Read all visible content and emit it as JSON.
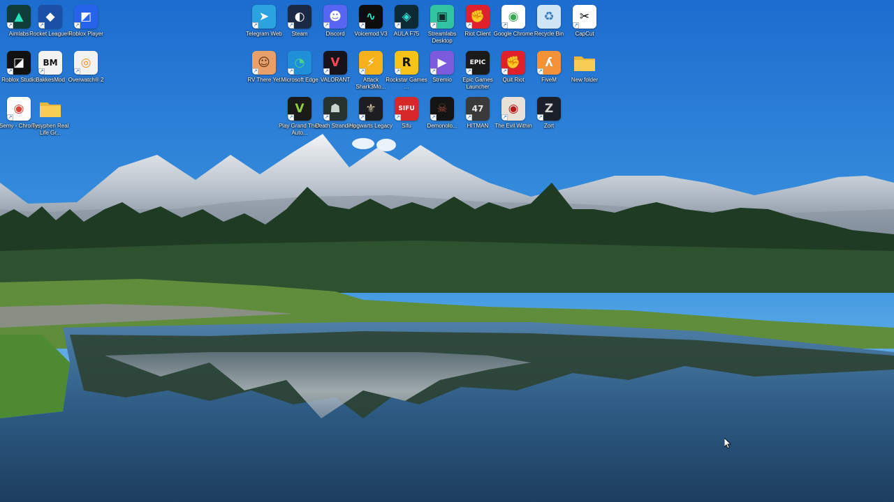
{
  "desktop": {
    "icons": [
      {
        "id": "aimlabs",
        "label": "Aimlabs",
        "icon": "aimlabs-icon",
        "color": "#0f3d3a",
        "fg": "#27e0c0",
        "glyph": "▲"
      },
      {
        "id": "rocket-league",
        "label": "Rocket League®",
        "icon": "rocket-league-icon",
        "color": "#1b4fa8",
        "fg": "#ffffff",
        "glyph": "◆"
      },
      {
        "id": "roblox-player",
        "label": "Roblox Player",
        "icon": "roblox-icon",
        "color": "#2563eb",
        "fg": "#ffffff",
        "glyph": "◩"
      },
      {
        "id": "roblox-studio",
        "label": "Roblox Studio",
        "icon": "roblox-studio-icon",
        "color": "#111111",
        "fg": "#ffffff",
        "glyph": "◪"
      },
      {
        "id": "bakkesmod",
        "label": "BakkesMod",
        "icon": "bakkesmod-icon",
        "color": "#f2f2f2",
        "fg": "#111111",
        "glyph": "BM"
      },
      {
        "id": "overwatch",
        "label": "Overwatch® 2",
        "icon": "overwatch-icon",
        "color": "#f2f2f2",
        "fg": "#f28c1d",
        "glyph": "◎"
      },
      {
        "id": "semy-chrome",
        "label": "Semy - Chrome",
        "icon": "chrome-icon",
        "color": "#ffffff",
        "fg": "#db4437",
        "glyph": "◉"
      },
      {
        "id": "tysyphen",
        "label": "Tysyphen Real Life Gr...",
        "icon": "folder-icon",
        "color": "#f5c542",
        "fg": "#c8961a",
        "glyph": ""
      },
      {
        "id": "telegram",
        "label": "Telegram Web",
        "icon": "telegram-icon",
        "color": "#2aa3e0",
        "fg": "#ffffff",
        "glyph": "➤"
      },
      {
        "id": "steam",
        "label": "Steam",
        "icon": "steam-icon",
        "color": "#1b2a44",
        "fg": "#ffffff",
        "glyph": "◐"
      },
      {
        "id": "discord",
        "label": "Discord",
        "icon": "discord-icon",
        "color": "#5865f2",
        "fg": "#ffffff",
        "glyph": "☻"
      },
      {
        "id": "voicemod",
        "label": "Voicemod V3",
        "icon": "voicemod-icon",
        "color": "#0d0d0d",
        "fg": "#27e8c8",
        "glyph": "∿"
      },
      {
        "id": "aula",
        "label": "AULA F75",
        "icon": "aula-icon",
        "color": "#0b2a36",
        "fg": "#2de0d6",
        "glyph": "◈"
      },
      {
        "id": "streamlabs",
        "label": "Streamlabs Desktop",
        "icon": "streamlabs-icon",
        "color": "#31c3a2",
        "fg": "#0d2b28",
        "glyph": "▣"
      },
      {
        "id": "riot-client",
        "label": "Riot Client",
        "icon": "riot-icon",
        "color": "#e0212b",
        "fg": "#ffffff",
        "glyph": "✊"
      },
      {
        "id": "google-chrome",
        "label": "Google Chrome",
        "icon": "chrome-icon",
        "color": "#ffffff",
        "fg": "#34a853",
        "glyph": "◉"
      },
      {
        "id": "recycle-bin",
        "label": "Recycle Bin",
        "icon": "recycle-bin-icon",
        "color": "#cfe4f5",
        "fg": "#3b7bbf",
        "glyph": "♻"
      },
      {
        "id": "capcut",
        "label": "CapCut",
        "icon": "capcut-icon",
        "color": "#ffffff",
        "fg": "#000000",
        "glyph": "✂"
      },
      {
        "id": "rv-there-yet",
        "label": "RV There Yet",
        "icon": "rv-there-yet-icon",
        "color": "#e8a06a",
        "fg": "#5a2d12",
        "glyph": "☺"
      },
      {
        "id": "edge",
        "label": "Microsoft Edge",
        "icon": "edge-icon",
        "color": "#1f8fd8",
        "fg": "#47d38a",
        "glyph": "◔"
      },
      {
        "id": "valorant",
        "label": "VALORANT",
        "icon": "valorant-icon",
        "color": "#16141a",
        "fg": "#ff4655",
        "glyph": "V"
      },
      {
        "id": "attack-shark",
        "label": "Attack Shark3Mo...",
        "icon": "attack-shark-icon",
        "color": "#f6b21b",
        "fg": "#ffffff",
        "glyph": "⚡"
      },
      {
        "id": "rockstar",
        "label": "Rockstar Games ...",
        "icon": "rockstar-icon",
        "color": "#f7c21a",
        "fg": "#111111",
        "glyph": "R"
      },
      {
        "id": "stremio",
        "label": "Stremio",
        "icon": "stremio-icon",
        "color": "#7b5bdc",
        "fg": "#ffffff",
        "glyph": "▶"
      },
      {
        "id": "epic-games",
        "label": "Epic Games Launcher",
        "icon": "epic-games-icon",
        "color": "#1a1a1a",
        "fg": "#ffffff",
        "glyph": "EPIC"
      },
      {
        "id": "quit-riot",
        "label": "Quit Riot",
        "icon": "riot-icon",
        "color": "#e0212b",
        "fg": "#ffffff",
        "glyph": "✊"
      },
      {
        "id": "fivem",
        "label": "FiveM",
        "icon": "fivem-icon",
        "color": "#f39237",
        "fg": "#ffffff",
        "glyph": "ʎ"
      },
      {
        "id": "new-folder",
        "label": "New folder",
        "icon": "folder-icon",
        "color": "#f5c542",
        "fg": "#c8961a",
        "glyph": ""
      },
      {
        "id": "gta-v",
        "label": "Play Grand Theft Auto...",
        "icon": "gta-v-icon",
        "color": "#1a1a1a",
        "fg": "#8fd13f",
        "glyph": "V"
      },
      {
        "id": "death-stranding",
        "label": "Death Stranding",
        "icon": "death-stranding-icon",
        "color": "#26332e",
        "fg": "#c9d6cf",
        "glyph": "☗"
      },
      {
        "id": "hogwarts-legacy",
        "label": "Hogwarts Legacy",
        "icon": "hogwarts-legacy-icon",
        "color": "#1d1d22",
        "fg": "#d8c9a3",
        "glyph": "⚜"
      },
      {
        "id": "sifu",
        "label": "Sifu",
        "icon": "sifu-icon",
        "color": "#d62828",
        "fg": "#ffffff",
        "glyph": "SIFU"
      },
      {
        "id": "demonologist",
        "label": "Demonolo...",
        "icon": "demonologist-icon",
        "color": "#141414",
        "fg": "#a84a3a",
        "glyph": "☠"
      },
      {
        "id": "hitman",
        "label": "HITMAN",
        "icon": "hitman-icon",
        "color": "#3a3a3a",
        "fg": "#e8e8e8",
        "glyph": "47"
      },
      {
        "id": "the-evil-within",
        "label": "The Evil Within",
        "icon": "the-evil-within-icon",
        "color": "#e9e1d8",
        "fg": "#b31c1c",
        "glyph": "◉"
      },
      {
        "id": "zort",
        "label": "Zort",
        "icon": "zort-icon",
        "color": "#1b1f2a",
        "fg": "#d0d0d0",
        "glyph": "Z"
      }
    ]
  },
  "colors": {
    "sky_top": "#1f6fd0",
    "sky_bottom": "#8fc6ef",
    "mountain": "#d9dee3",
    "forest": "#1f3a22",
    "water": "#2b5d8e"
  }
}
